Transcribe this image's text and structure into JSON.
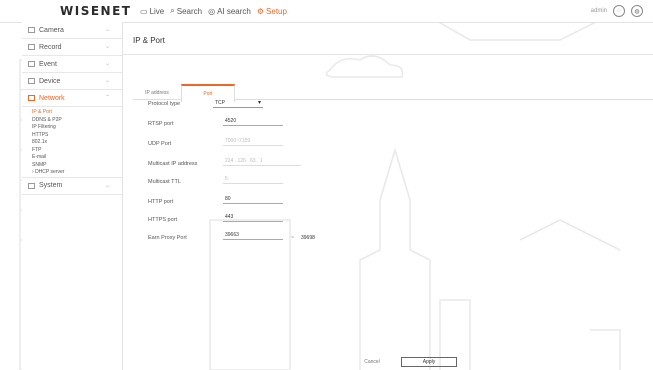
{
  "app": {
    "logo": "WISENET"
  },
  "topnav": [
    {
      "icon": "monitor-icon",
      "label": "Live"
    },
    {
      "icon": "search-icon",
      "label": "Search"
    },
    {
      "icon": "ai-icon",
      "label": "AI search"
    },
    {
      "icon": "gear-icon",
      "label": "Setup"
    }
  ],
  "topright": {
    "user": "admin"
  },
  "sidebar": {
    "menus": [
      {
        "label": "Camera",
        "icon": "camera-icon"
      },
      {
        "label": "Record",
        "icon": "record-icon"
      },
      {
        "label": "Event",
        "icon": "bell-icon"
      },
      {
        "label": "Device",
        "icon": "device-icon"
      },
      {
        "label": "Network",
        "icon": "network-icon"
      }
    ],
    "network_sub": [
      "IP & Port",
      "DDNS & P2P",
      "IP Filtering",
      "HTTPS",
      "802.1x",
      "FTP",
      "E-mail",
      "SNMP",
      "DHCP server"
    ],
    "system": {
      "label": "System",
      "icon": "system-icon"
    }
  },
  "main": {
    "title": "IP & Port",
    "tabs": [
      "IP address",
      "Port"
    ],
    "fields": {
      "protocol_label": "Protocol type",
      "protocol_value": "TCP",
      "rtsp_label": "RTSP port",
      "rtsp_value": "4520",
      "udp_label": "UDP Port",
      "udp_value": "7000~7159",
      "mcast_label": "Multicast IP address",
      "mcast_value": "224 . 126 . 63 . 1",
      "ttl_label": "Multicast TTL",
      "ttl_value": "5",
      "http_label": "HTTP port",
      "http_value": "80",
      "https_label": "HTTPS port",
      "https_value": "443",
      "proxy_label": "Earn Proxy Port",
      "proxy_from": "39663",
      "proxy_to": "39698"
    },
    "buttons": {
      "cancel": "Cancel",
      "apply": "Apply"
    }
  }
}
